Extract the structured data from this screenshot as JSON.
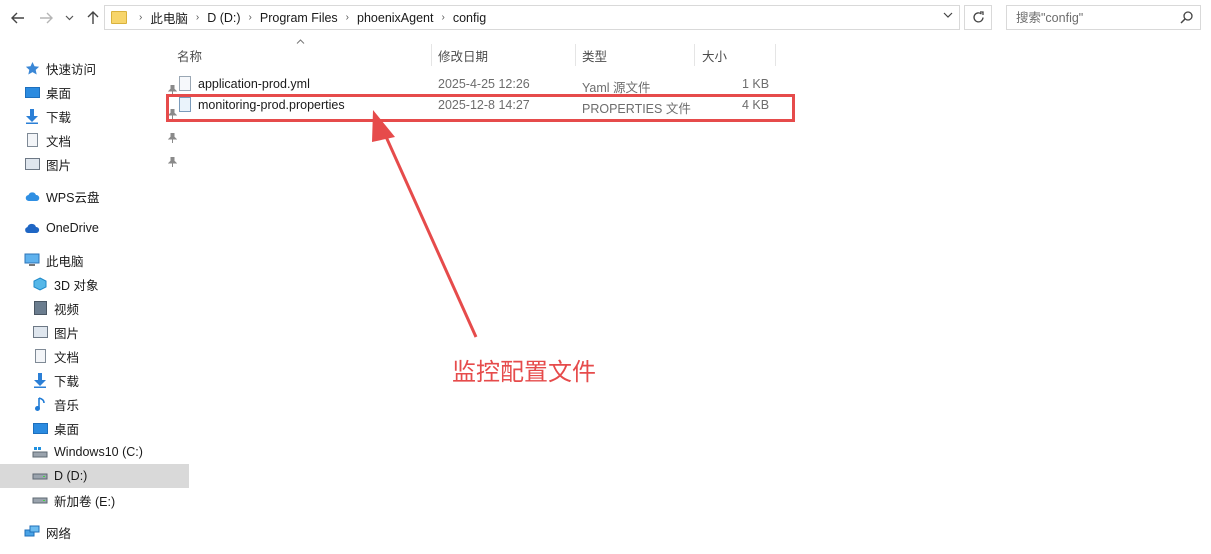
{
  "address": {
    "crumbs": [
      "此电脑",
      "D (D:)",
      "Program Files",
      "phoenixAgent",
      "config"
    ]
  },
  "search": {
    "placeholder": "搜索\"config\""
  },
  "sidebar": {
    "quick_access": "快速访问",
    "quick_items": [
      "桌面",
      "下载",
      "文档",
      "图片"
    ],
    "wps": "WPS云盘",
    "onedrive": "OneDrive",
    "this_pc": "此电脑",
    "pc_items": [
      "3D 对象",
      "视频",
      "图片",
      "文档",
      "下载",
      "音乐",
      "桌面",
      "Windows10 (C:)",
      "D (D:)",
      "新加卷 (E:)"
    ],
    "network": "网络"
  },
  "columns": {
    "name": "名称",
    "modified": "修改日期",
    "type": "类型",
    "size": "大小"
  },
  "files": [
    {
      "name": "application-prod.yml",
      "modified": "2025-4-25 12:26",
      "type": "Yaml 源文件",
      "size": "1 KB"
    },
    {
      "name": "monitoring-prod.properties",
      "modified": "2025-12-8 14:27",
      "type": "PROPERTIES 文件",
      "size": "4 KB"
    }
  ],
  "annotation": {
    "text": "监控配置文件",
    "color": "#e64b4b"
  },
  "icons": [
    "back-arrow-icon",
    "forward-arrow-icon",
    "recent-chevron-icon",
    "up-arrow-icon",
    "folder-icon",
    "refresh-icon",
    "search-icon",
    "pin-icon",
    "file-icon"
  ]
}
